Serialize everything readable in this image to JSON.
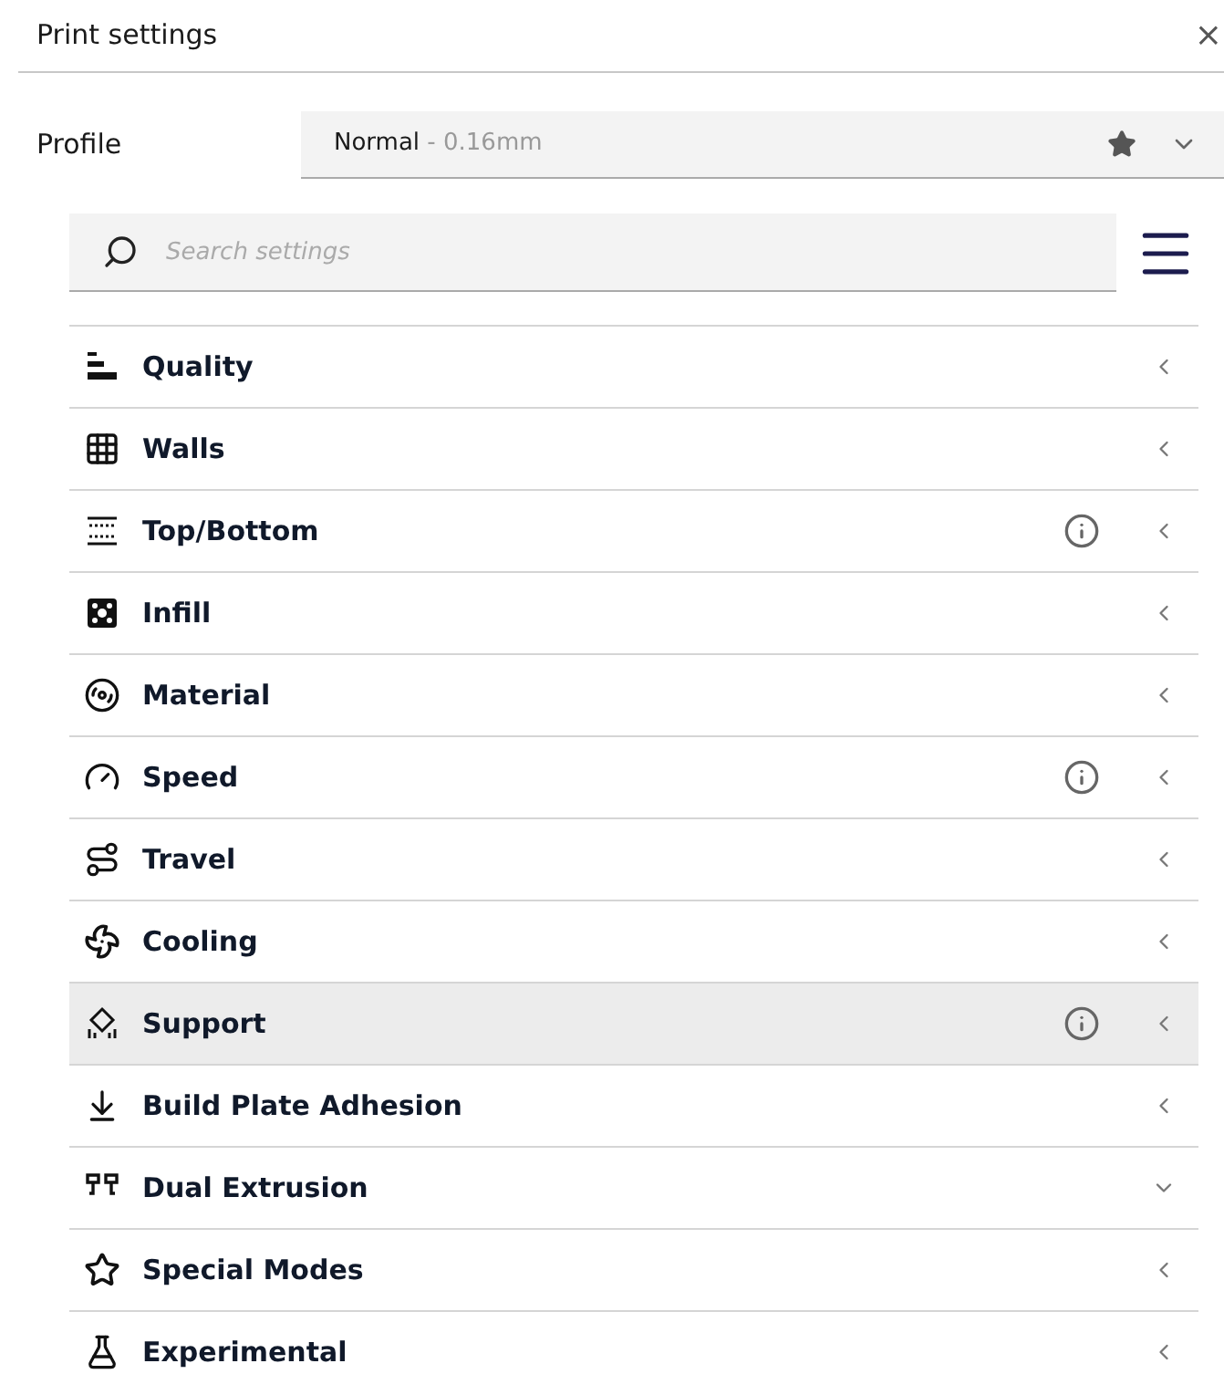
{
  "window": {
    "title": "Print settings",
    "close": "×"
  },
  "profile": {
    "label": "Profile",
    "name": "Normal",
    "detail": " - 0.16mm",
    "favorite": true
  },
  "search": {
    "placeholder": "Search settings"
  },
  "categories": [
    {
      "label": "Quality",
      "info": false,
      "expanded": false,
      "highlighted": false
    },
    {
      "label": "Walls",
      "info": false,
      "expanded": false,
      "highlighted": false
    },
    {
      "label": "Top/Bottom",
      "info": true,
      "expanded": false,
      "highlighted": false
    },
    {
      "label": "Infill",
      "info": false,
      "expanded": false,
      "highlighted": false
    },
    {
      "label": "Material",
      "info": false,
      "expanded": false,
      "highlighted": false
    },
    {
      "label": "Speed",
      "info": true,
      "expanded": false,
      "highlighted": false
    },
    {
      "label": "Travel",
      "info": false,
      "expanded": false,
      "highlighted": false
    },
    {
      "label": "Cooling",
      "info": false,
      "expanded": false,
      "highlighted": false
    },
    {
      "label": "Support",
      "info": true,
      "expanded": false,
      "highlighted": true
    },
    {
      "label": "Build Plate Adhesion",
      "info": false,
      "expanded": false,
      "highlighted": false
    },
    {
      "label": "Dual Extrusion",
      "info": false,
      "expanded": true,
      "highlighted": false
    },
    {
      "label": "Special Modes",
      "info": false,
      "expanded": false,
      "highlighted": false
    },
    {
      "label": "Experimental",
      "info": false,
      "expanded": false,
      "highlighted": false
    }
  ]
}
